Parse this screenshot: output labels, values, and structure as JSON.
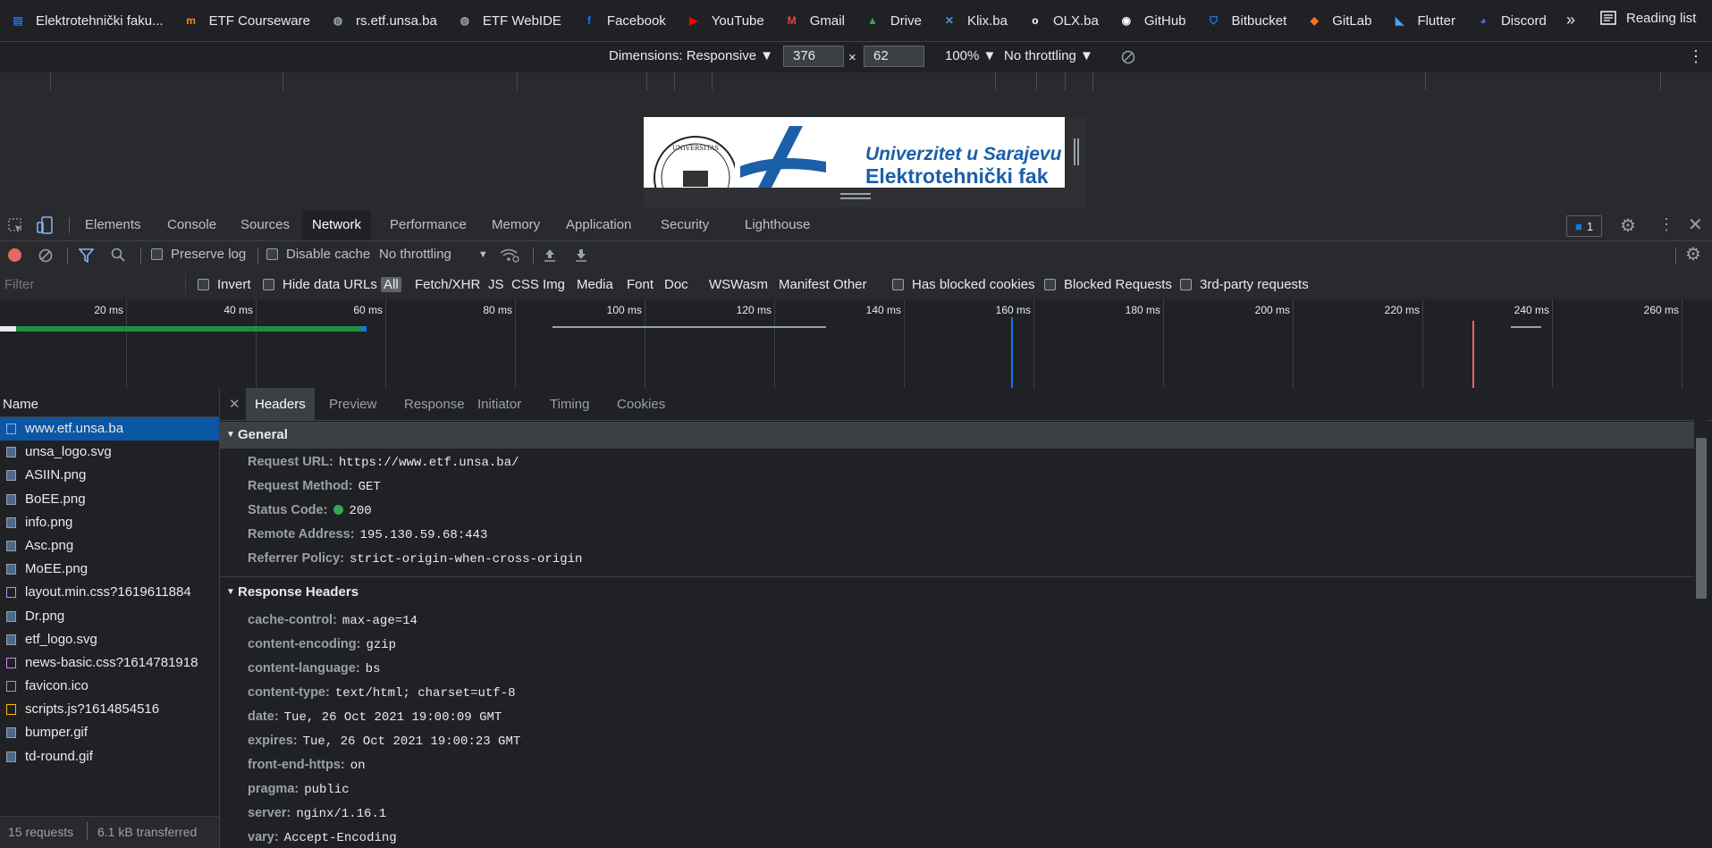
{
  "bookmarks": {
    "items": [
      {
        "label": "Elektrotehnički faku...",
        "icon": "etf-logo-icon",
        "color": "#1a73e8"
      },
      {
        "label": "ETF Courseware",
        "icon": "moodle-icon",
        "color": "#f98012"
      },
      {
        "label": "rs.etf.unsa.ba",
        "icon": "globe-icon",
        "color": "#9aa0a6"
      },
      {
        "label": "ETF WebIDE",
        "icon": "globe-icon",
        "color": "#9aa0a6"
      },
      {
        "label": "Facebook",
        "icon": "facebook-icon",
        "color": "#1877f2"
      },
      {
        "label": "YouTube",
        "icon": "youtube-icon",
        "color": "#ff0000"
      },
      {
        "label": "Gmail",
        "icon": "gmail-icon",
        "color": "#ea4335"
      },
      {
        "label": "Drive",
        "icon": "drive-icon",
        "color": "#34a853"
      },
      {
        "label": "Klix.ba",
        "icon": "klix-icon",
        "color": "#4a90d9"
      },
      {
        "label": "OLX.ba",
        "icon": "olx-icon",
        "color": "#ffffff"
      },
      {
        "label": "GitHub",
        "icon": "github-icon",
        "color": "#ffffff"
      },
      {
        "label": "Bitbucket",
        "icon": "bitbucket-icon",
        "color": "#2684ff"
      },
      {
        "label": "GitLab",
        "icon": "gitlab-icon",
        "color": "#fc6d26"
      },
      {
        "label": "Flutter",
        "icon": "flutter-icon",
        "color": "#42a5f5"
      },
      {
        "label": "Discord",
        "icon": "discord-icon",
        "color": "#5865f2"
      }
    ],
    "more": "»",
    "reading_list": "Reading list"
  },
  "device_toolbar": {
    "dimensions": "Dimensions: Responsive ▼",
    "width": "376",
    "times": "×",
    "height": "62",
    "zoom": "100% ▼",
    "throttling": "No throttling ▼"
  },
  "device_preview": {
    "line1": "Univerzitet u Sarajevu",
    "line2": "Elektrotehnički fak"
  },
  "devtools_tabs": [
    "Elements",
    "Console",
    "Sources",
    "Network",
    "Performance",
    "Memory",
    "Application",
    "Security",
    "Lighthouse"
  ],
  "active_tab": "Network",
  "issues_count": "1",
  "network_toolbar": {
    "preserve_log": "Preserve log",
    "disable_cache": "Disable cache",
    "throttling": "No throttling"
  },
  "filter_bar": {
    "placeholder": "Filter",
    "invert": "Invert",
    "hide_data_urls": "Hide data URLs",
    "types": [
      "All",
      "Fetch/XHR",
      "JS",
      "CSS",
      "Img",
      "Media",
      "Font",
      "Doc",
      "WS",
      "Wasm",
      "Manifest",
      "Other"
    ],
    "has_blocked_cookies": "Has blocked cookies",
    "blocked_requests": "Blocked Requests",
    "third_party": "3rd-party requests"
  },
  "timeline": {
    "labels": [
      "20 ms",
      "40 ms",
      "60 ms",
      "80 ms",
      "100 ms",
      "120 ms",
      "140 ms",
      "160 ms",
      "180 ms",
      "200 ms",
      "220 ms",
      "240 ms",
      "260 ms"
    ]
  },
  "request_list": {
    "header": "Name",
    "rows": [
      {
        "name": "www.etf.unsa.ba",
        "type": "doc",
        "selected": true
      },
      {
        "name": "unsa_logo.svg",
        "type": "img"
      },
      {
        "name": "ASIIN.png",
        "type": "img"
      },
      {
        "name": "BoEE.png",
        "type": "img"
      },
      {
        "name": "info.png",
        "type": "img"
      },
      {
        "name": "Asc.png",
        "type": "img"
      },
      {
        "name": "MoEE.png",
        "type": "img"
      },
      {
        "name": "layout.min.css?1619611884",
        "type": "css"
      },
      {
        "name": "Dr.png",
        "type": "img"
      },
      {
        "name": "etf_logo.svg",
        "type": "img"
      },
      {
        "name": "news-basic.css?1614781918",
        "type": "css"
      },
      {
        "name": "favicon.ico",
        "type": "other"
      },
      {
        "name": "scripts.js?1614854516",
        "type": "js"
      },
      {
        "name": "bumper.gif",
        "type": "img"
      },
      {
        "name": "td-round.gif",
        "type": "img"
      }
    ],
    "footer_requests": "15 requests",
    "footer_transferred": "6.1 kB transferred"
  },
  "details": {
    "tabs": [
      "Headers",
      "Preview",
      "Response",
      "Initiator",
      "Timing",
      "Cookies"
    ],
    "active": "Headers",
    "general_title": "General",
    "general": [
      {
        "k": "Request URL:",
        "v": "https://www.etf.unsa.ba/"
      },
      {
        "k": "Request Method:",
        "v": "GET"
      },
      {
        "k": "Status Code:",
        "v": "200"
      },
      {
        "k": "Remote Address:",
        "v": "195.130.59.68:443"
      },
      {
        "k": "Referrer Policy:",
        "v": "strict-origin-when-cross-origin"
      }
    ],
    "response_title": "Response Headers",
    "response": [
      {
        "k": "cache-control:",
        "v": "max-age=14"
      },
      {
        "k": "content-encoding:",
        "v": "gzip"
      },
      {
        "k": "content-language:",
        "v": "bs"
      },
      {
        "k": "content-type:",
        "v": "text/html; charset=utf-8"
      },
      {
        "k": "date:",
        "v": "Tue, 26 Oct 2021 19:00:09 GMT"
      },
      {
        "k": "expires:",
        "v": "Tue, 26 Oct 2021 19:00:23 GMT"
      },
      {
        "k": "front-end-https:",
        "v": "on"
      },
      {
        "k": "pragma:",
        "v": "public"
      },
      {
        "k": "server:",
        "v": "nginx/1.16.1"
      },
      {
        "k": "vary:",
        "v": "Accept-Encoding"
      }
    ],
    "status_color": "#34a853"
  }
}
